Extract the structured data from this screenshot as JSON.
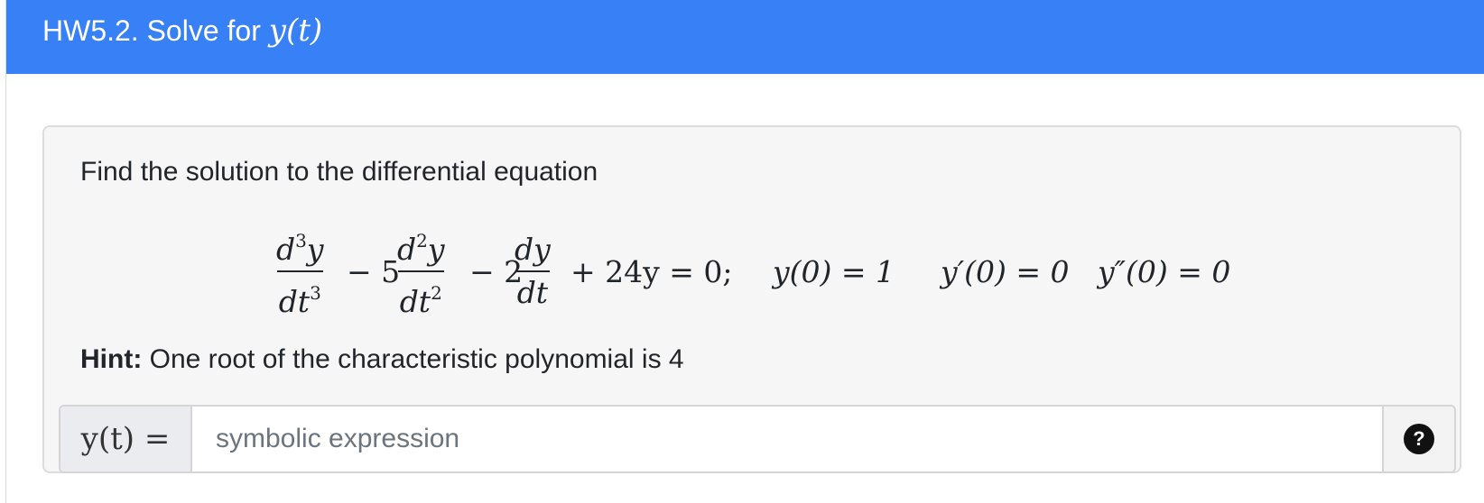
{
  "header": {
    "title_prefix": "HW5.2. Solve for ",
    "title_math": "y(t)"
  },
  "question": {
    "prompt": "Find the solution to the differential equation",
    "equation": {
      "term1_num": "d",
      "term1_num_exp": "3",
      "term1_num_var": "y",
      "term1_den": "dt",
      "term1_den_exp": "3",
      "op1": "− 5",
      "term2_num": "d",
      "term2_num_exp": "2",
      "term2_num_var": "y",
      "term2_den": "dt",
      "term2_den_exp": "2",
      "op2": "− 2",
      "term3_num": "dy",
      "term3_den": "dt",
      "tail": "+ 24y = 0;",
      "ic1": "y(0) = 1",
      "ic2": "y′(0) = 0",
      "ic3": "y″(0) = 0"
    },
    "hint_label": "Hint:",
    "hint_text": " One root of the characteristic polynomial is 4"
  },
  "answer": {
    "label": "y(t) =",
    "placeholder": "symbolic expression",
    "value": "",
    "help_symbol": "?"
  }
}
